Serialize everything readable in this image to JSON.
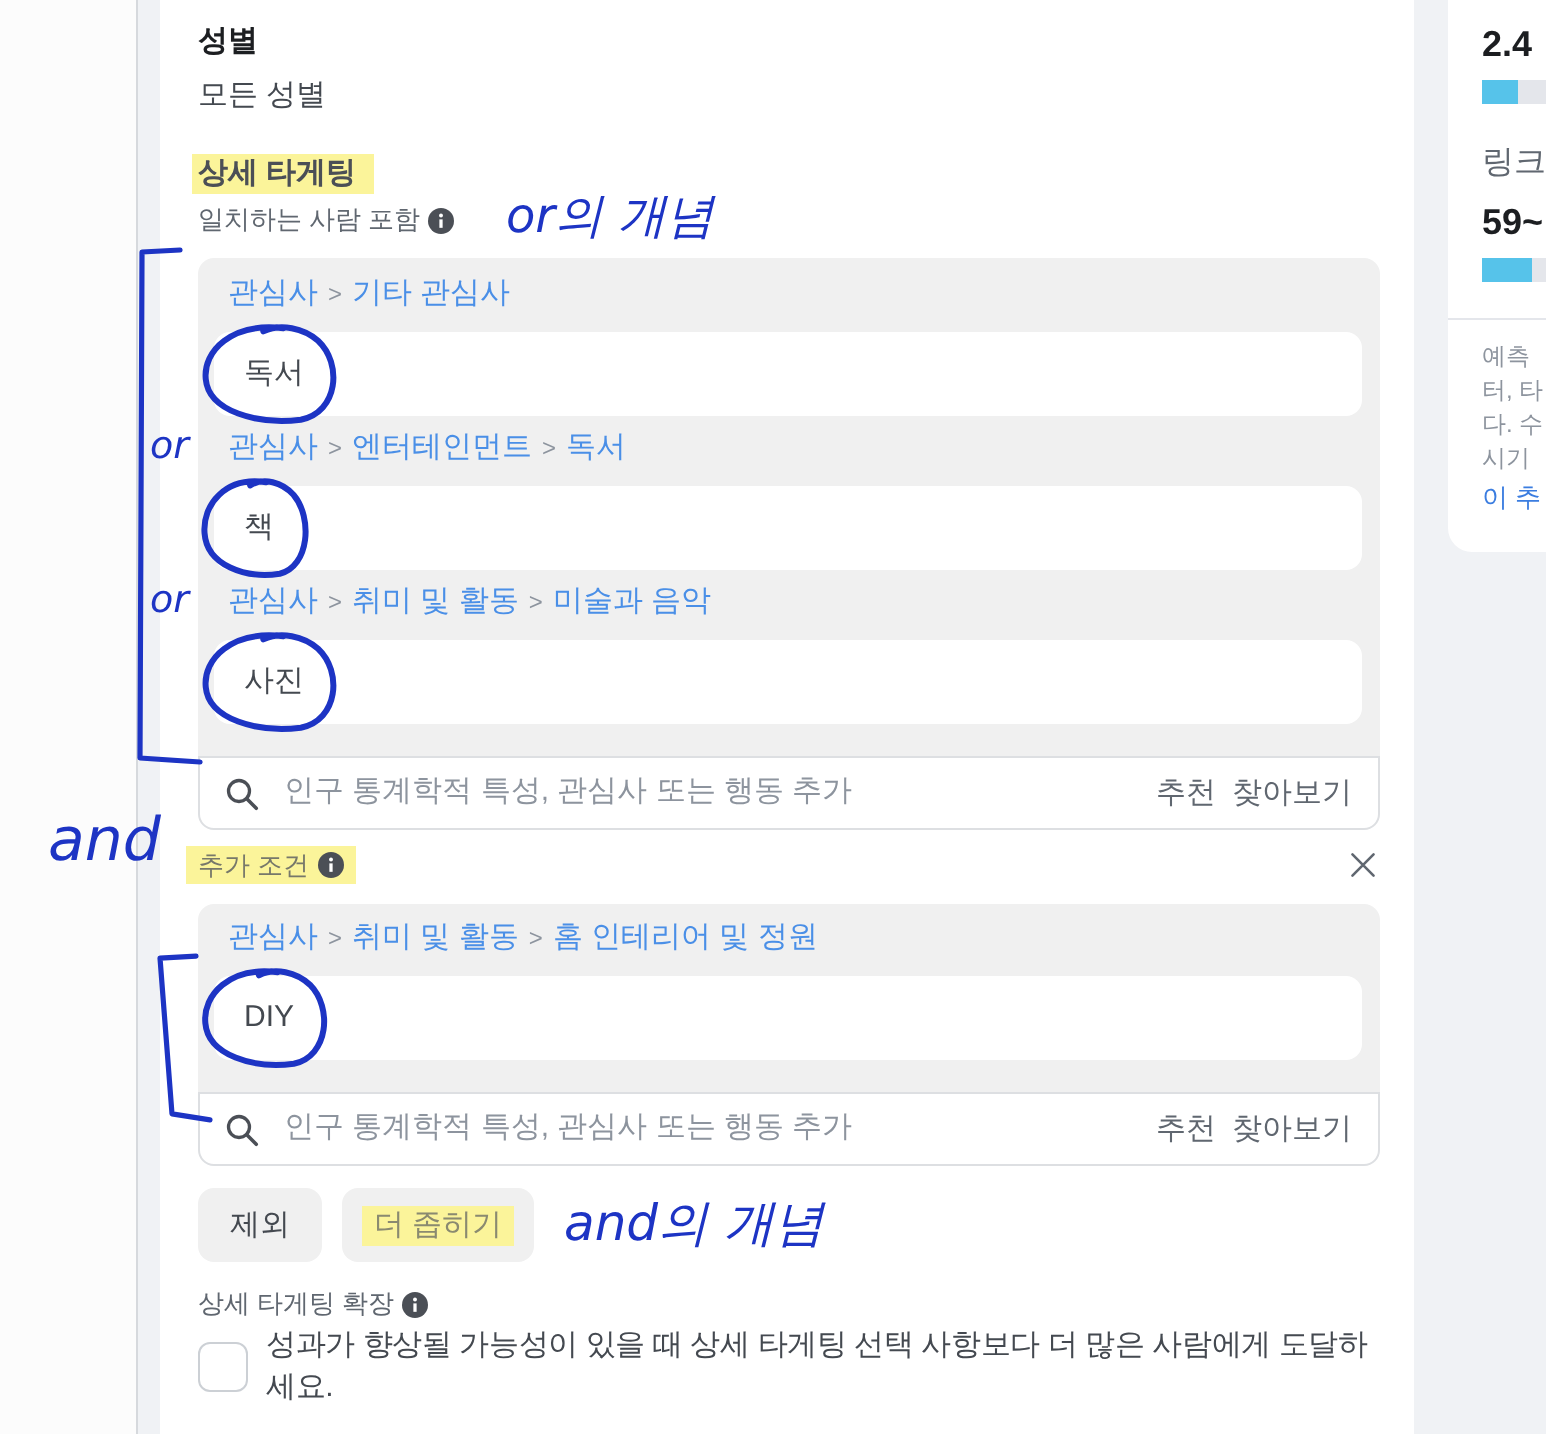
{
  "filter_panel": {
    "gender": {
      "label": "성별",
      "value": "모든 성별"
    },
    "detailed_targeting": {
      "title": "상세 타게팅",
      "highlighted": true,
      "include": {
        "label": "일치하는 사람 포함",
        "ink_note": "or의 개념",
        "bracketed": true,
        "items": [
          {
            "path": [
              "관심사",
              ">",
              "기타 관심사"
            ],
            "value": "독서",
            "circled": true
          },
          {
            "path": [
              "관심사",
              ">",
              "엔터테인먼트",
              ">",
              "독서"
            ],
            "value": "책",
            "circled": true,
            "ink_note": "or"
          },
          {
            "path": [
              "관심사",
              ">",
              "취미 및 활동",
              ">",
              "미술과 음악"
            ],
            "value": "사진",
            "circled": true,
            "ink_note": "or"
          }
        ],
        "search": {
          "placeholder": "인구 통계학적 특성, 관심사 또는 행동 추가",
          "actions": [
            "추천",
            "찾아보기"
          ]
        }
      },
      "narrow": {
        "label": "추가 조건",
        "highlighted": true,
        "ink_note": "and",
        "bracketed": true,
        "items": [
          {
            "path": [
              "관심사",
              ">",
              "취미 및 활동",
              ">",
              "홈 인테리어 및 정원"
            ],
            "value": "DIY",
            "circled": true
          }
        ],
        "search": {
          "placeholder": "인구 통계학적 특성, 관심사 또는 행동 추가",
          "actions": [
            "추천",
            "찾아보기"
          ]
        }
      },
      "buttons": [
        {
          "label": "제외",
          "highlighted": false
        },
        {
          "label": "더 좁히기",
          "highlighted": true,
          "ink_note": "and의 개념"
        }
      ],
      "expansion": {
        "label": "상세 타게팅 확장",
        "checked": false,
        "text": "성과가 향상될 가능성이 있을 때 상세 타게팅 선택 사항보다 더 많은 사람에게 도달하세요."
      }
    }
  },
  "estimate_panel": {
    "metrics": [
      {
        "value": "2.4",
        "level": 0.15
      },
      {
        "label": "링크",
        "value": "59~",
        "level": 0.21
      }
    ],
    "note": [
      "예측",
      "터, 타",
      "다. 수",
      "시기"
    ],
    "link": "이 추"
  }
}
